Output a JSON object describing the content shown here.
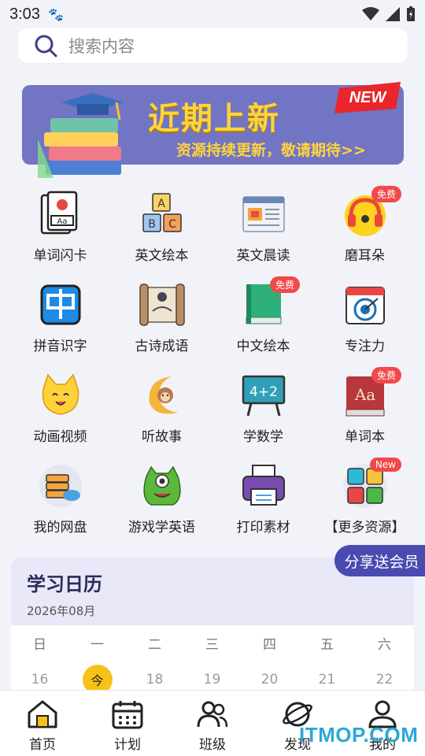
{
  "status_bar": {
    "time": "3:03"
  },
  "search": {
    "placeholder": "搜索内容"
  },
  "banner": {
    "title": "近期上新",
    "subtitle": "资源持续更新，敬请期待>>",
    "tag": "NEW"
  },
  "grid": [
    {
      "label": "单词闪卡",
      "icon": "word-flashcard-icon"
    },
    {
      "label": "英文绘本",
      "icon": "abc-blocks-icon"
    },
    {
      "label": "英文晨读",
      "icon": "newspaper-icon"
    },
    {
      "label": "磨耳朵",
      "icon": "headphones-icon",
      "badge": "免费"
    },
    {
      "label": "拼音识字",
      "icon": "pinyin-icon"
    },
    {
      "label": "古诗成语",
      "icon": "scroll-icon"
    },
    {
      "label": "中文绘本",
      "icon": "green-book-icon",
      "badge": "免费"
    },
    {
      "label": "专注力",
      "icon": "target-icon"
    },
    {
      "label": "动画视频",
      "icon": "cat-face-icon"
    },
    {
      "label": "听故事",
      "icon": "moon-monkey-icon"
    },
    {
      "label": "学数学",
      "icon": "math-board-icon"
    },
    {
      "label": "单词本",
      "icon": "dictionary-icon",
      "badge": "免费"
    },
    {
      "label": "我的网盘",
      "icon": "cloud-drive-icon"
    },
    {
      "label": "游戏学英语",
      "icon": "green-monster-icon"
    },
    {
      "label": "打印素材",
      "icon": "printer-icon"
    },
    {
      "label": "【更多资源】",
      "icon": "app-grid-icon",
      "badge": "New"
    }
  ],
  "share": {
    "label": "分享送会员"
  },
  "calendar": {
    "title": "学习日历",
    "month": "2026年08月",
    "weekdays": [
      "日",
      "一",
      "二",
      "三",
      "四",
      "五",
      "六"
    ],
    "days": [
      "16",
      "今",
      "18",
      "19",
      "20",
      "21",
      "22"
    ]
  },
  "tabs": [
    {
      "label": "首页",
      "icon": "home-icon",
      "active": true
    },
    {
      "label": "计划",
      "icon": "calendar-icon"
    },
    {
      "label": "班级",
      "icon": "group-icon"
    },
    {
      "label": "发现",
      "icon": "planet-icon"
    },
    {
      "label": "我的",
      "icon": "user-icon"
    }
  ],
  "watermark": "ITMOP.COM",
  "colors": {
    "accent": "#4a4ab0",
    "banner": "#7274c4",
    "today": "#f6c219",
    "badge": "#f2494a"
  }
}
